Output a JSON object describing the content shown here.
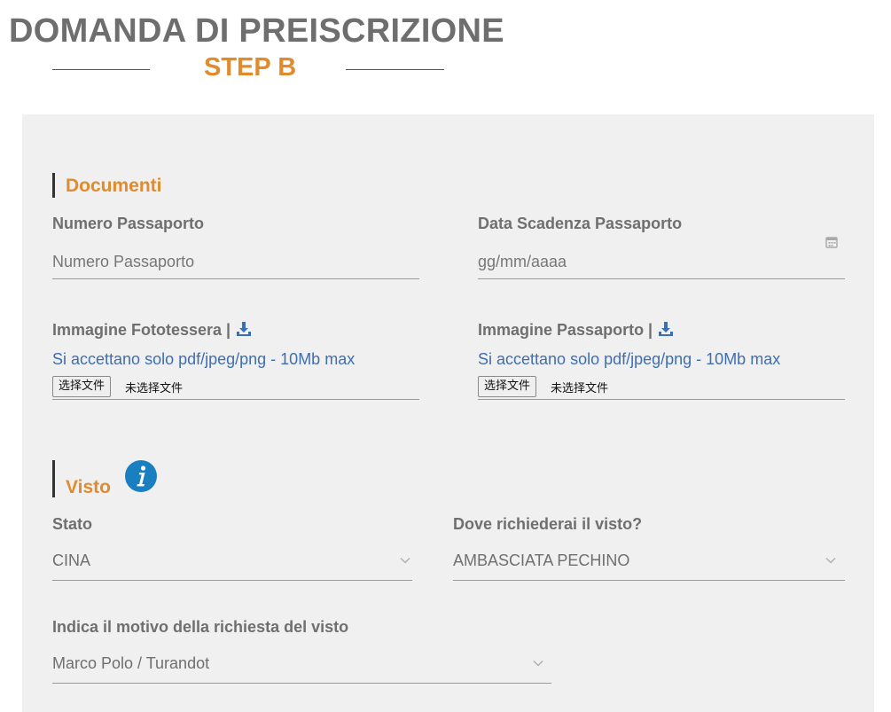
{
  "header": {
    "title": "DOMANDA DI PREISCRIZIONE",
    "step": "STEP B"
  },
  "colors": {
    "accent": "#e08b2c",
    "hint": "#3f6eb0",
    "panel": "#f0f0f0",
    "info": "#1a7fc1"
  },
  "documenti": {
    "heading": "Documenti",
    "passport_number": {
      "label": "Numero Passaporto",
      "placeholder": "Numero Passaporto"
    },
    "passport_expiry": {
      "label": "Data Scadenza Passaporto",
      "placeholder": "gg/mm/aaaa",
      "icon": "calendar-icon"
    },
    "photo_upload": {
      "label": "Immagine Fototessera |",
      "icon": "download-icon",
      "hint": "Si accettano solo pdf/jpeg/png - 10Mb max",
      "button": "选择文件",
      "status": "未选择文件"
    },
    "passport_upload": {
      "label": "Immagine Passaporto |",
      "icon": "download-icon",
      "hint": "Si accettano solo pdf/jpeg/png - 10Mb max",
      "button": "选择文件",
      "status": "未选择文件"
    }
  },
  "visto": {
    "heading": "Visto",
    "info_icon": "info-icon",
    "state": {
      "label": "Stato",
      "value": "CINA"
    },
    "where": {
      "label": "Dove richiederai il visto?",
      "value": "AMBASCIATA PECHINO"
    },
    "reason": {
      "label": "Indica il motivo della richiesta del visto",
      "value": "Marco Polo / Turandot"
    }
  }
}
